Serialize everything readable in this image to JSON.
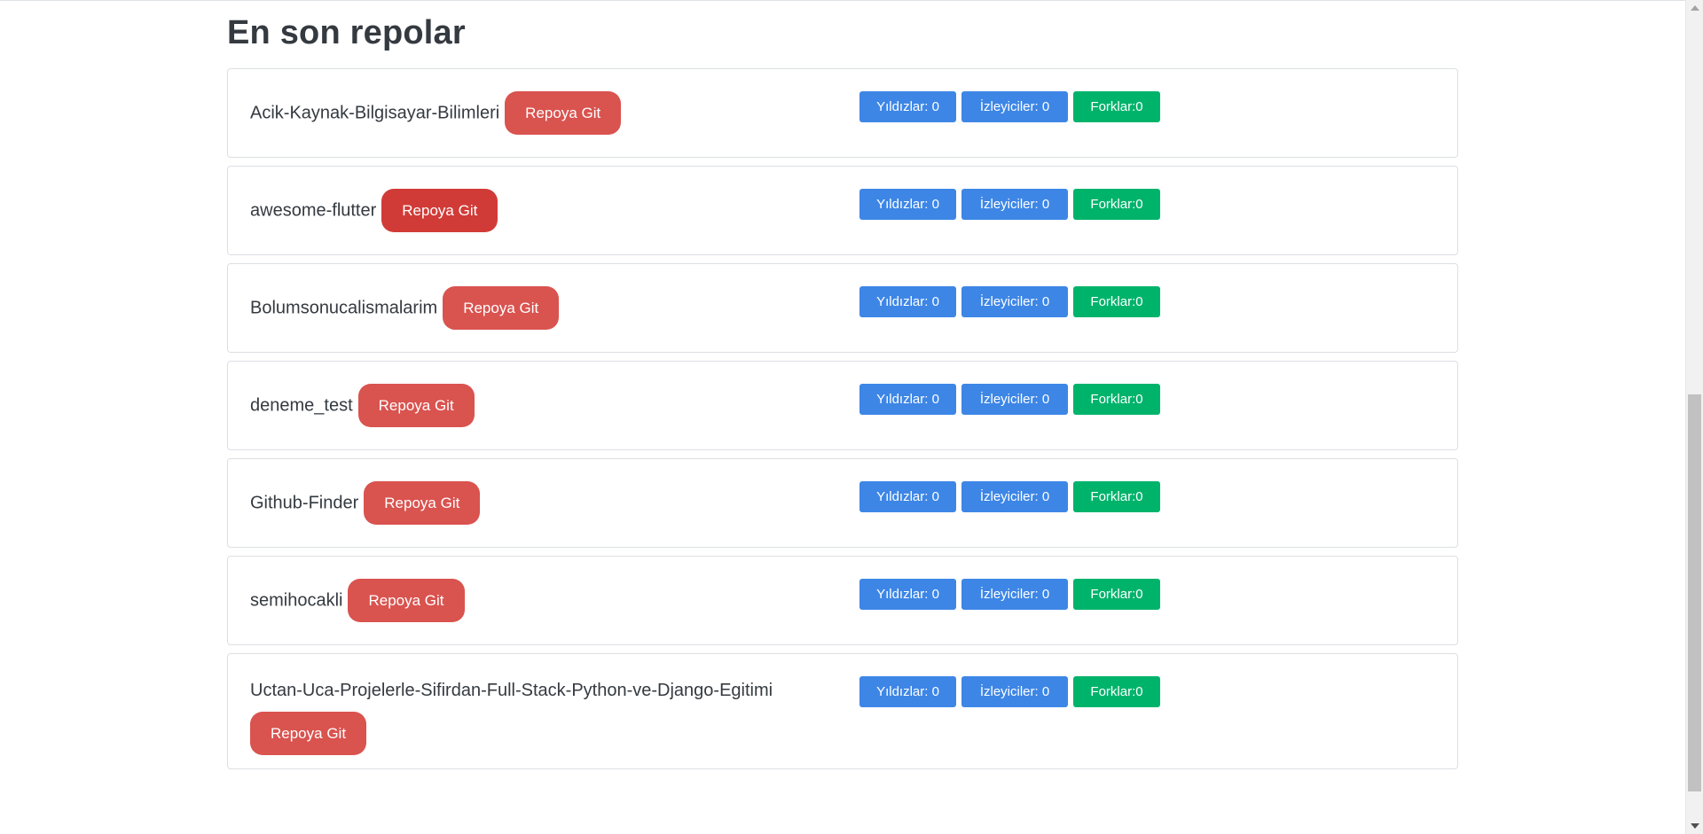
{
  "section_title": "En son repolar",
  "repo_button_label": "Repoya Git",
  "repos": [
    {
      "name": "Acik-Kaynak-Bilgisayar-Bilimleri",
      "stars": "Yıldızlar: 0",
      "watchers": "İzleyiciler: 0",
      "forks": "Forklar:0"
    },
    {
      "name": "awesome-flutter",
      "stars": "Yıldızlar: 0",
      "watchers": "İzleyiciler: 0",
      "forks": "Forklar:0"
    },
    {
      "name": "Bolumsonucalismalarim",
      "stars": "Yıldızlar: 0",
      "watchers": "İzleyiciler: 0",
      "forks": "Forklar:0"
    },
    {
      "name": "deneme_test",
      "stars": "Yıldızlar: 0",
      "watchers": "İzleyiciler: 0",
      "forks": "Forklar:0"
    },
    {
      "name": "Github-Finder",
      "stars": "Yıldızlar: 0",
      "watchers": "İzleyiciler: 0",
      "forks": "Forklar:0"
    },
    {
      "name": "semihocakli",
      "stars": "Yıldızlar: 0",
      "watchers": "İzleyiciler: 0",
      "forks": "Forklar:0"
    },
    {
      "name": "Uctan-Uca-Projelerle-Sifirdan-Full-Stack-Python-ve-Django-Egitimi",
      "stars": "Yıldızlar: 0",
      "watchers": "İzleyiciler: 0",
      "forks": "Forklar:0"
    }
  ],
  "colors": {
    "danger": "#d9534f",
    "danger_hover": "#d13b37",
    "primary": "#3d86e6",
    "success": "#00b36b",
    "text": "#343a40"
  }
}
